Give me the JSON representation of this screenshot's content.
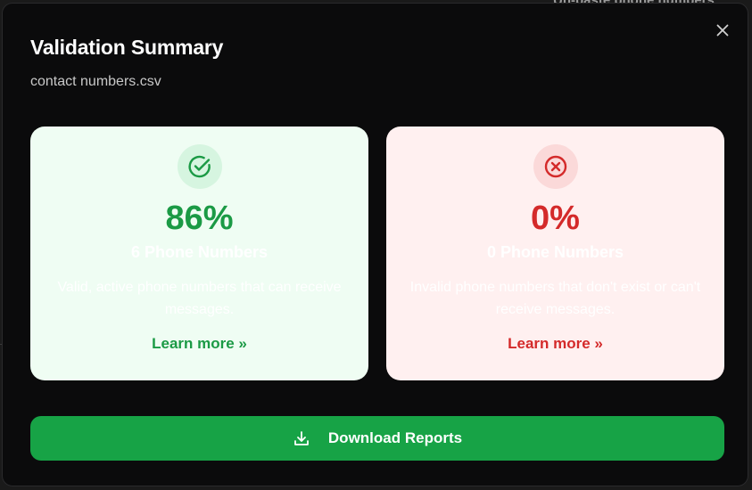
{
  "background": {
    "peek_text": "Un-paste phone numbers"
  },
  "modal": {
    "title": "Validation Summary",
    "subtitle": "contact numbers.csv",
    "close_icon": "close-icon"
  },
  "cards": {
    "valid": {
      "icon": "check-circle-icon",
      "percent": "86%",
      "count_label": "6 Phone Numbers",
      "description": "Valid, active phone numbers that can receive messages.",
      "link_label": "Learn more »",
      "accent_color": "#1b9a45",
      "background_color": "#effdf3"
    },
    "invalid": {
      "icon": "x-circle-icon",
      "percent": "0%",
      "count_label": "0 Phone Numbers",
      "description": "Invalid phone numbers that don't exist or can't receive messages.",
      "link_label": "Learn more »",
      "accent_color": "#d42a2a",
      "background_color": "#fff0f0"
    }
  },
  "footer": {
    "download_label": "Download Reports",
    "download_icon": "download-icon",
    "button_color": "#17a346"
  }
}
